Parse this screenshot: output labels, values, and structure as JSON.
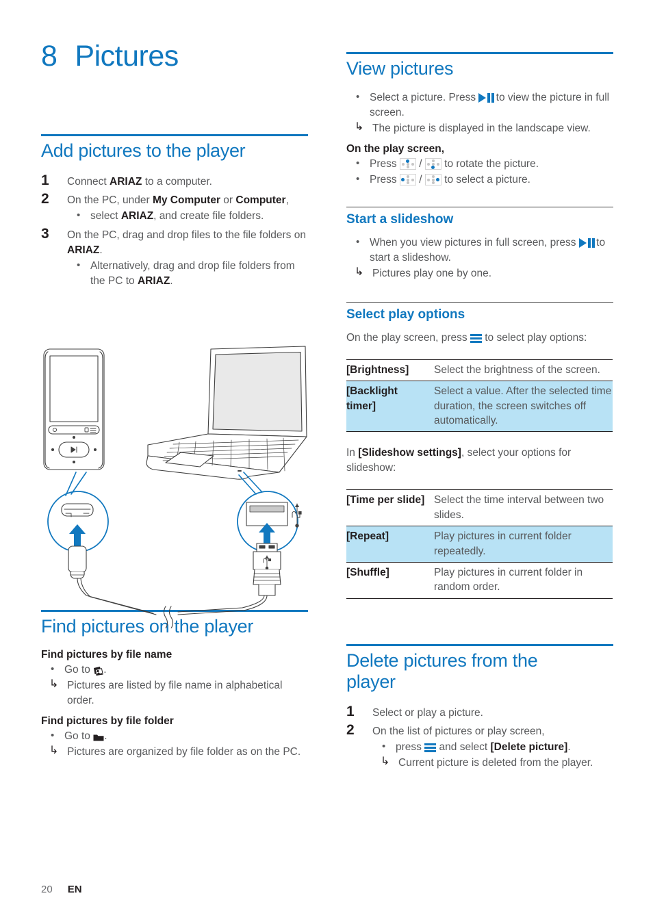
{
  "chapter": {
    "number": "8",
    "title": "Pictures"
  },
  "colors": {
    "accent": "#1178bf",
    "highlight_row": "#b8e2f5",
    "body_text": "#58595b",
    "strong_text": "#231f20"
  },
  "left_column": {
    "section_add": {
      "heading": "Add pictures to the player",
      "steps": [
        {
          "num": "1",
          "text_parts": [
            {
              "t": "Connect ",
              "b": false
            },
            {
              "t": "ARIAZ",
              "b": true
            },
            {
              "t": " to a computer.",
              "b": false
            }
          ]
        },
        {
          "num": "2",
          "text_parts": [
            {
              "t": "On the PC, under ",
              "b": false
            },
            {
              "t": "My Computer",
              "b": true
            },
            {
              "t": " or ",
              "b": false
            },
            {
              "t": "Computer",
              "b": true
            },
            {
              "t": ",",
              "b": false
            }
          ],
          "bullets": [
            [
              {
                "t": "select ",
                "b": false
              },
              {
                "t": "ARIAZ",
                "b": true
              },
              {
                "t": ", and create file folders.",
                "b": false
              }
            ]
          ]
        },
        {
          "num": "3",
          "text_parts": [
            {
              "t": "On the PC, drag and drop files to the file folders on ",
              "b": false
            },
            {
              "t": "ARIAZ",
              "b": true
            },
            {
              "t": ".",
              "b": false
            }
          ],
          "bullets": [
            [
              {
                "t": "Alternatively, drag and drop file folders from the PC to ",
                "b": false
              },
              {
                "t": "ARIAZ",
                "b": true
              },
              {
                "t": ".",
                "b": false
              }
            ]
          ]
        }
      ]
    },
    "illustration": {
      "name": "connect-player-to-pc-diagram",
      "parts": [
        "mp3-player",
        "laptop",
        "usb-micro-connector-callout",
        "usb-a-port-callout",
        "usb-cable"
      ]
    },
    "section_find": {
      "heading": "Find pictures on the player",
      "blocks": [
        {
          "lead": "Find pictures by file name",
          "bullet_prefix": "Go to ",
          "bullet_icon": "photo-icon",
          "bullet_suffix": ".",
          "result": "Pictures are listed by file name in alphabetical order."
        },
        {
          "lead": "Find pictures by file folder",
          "bullet_prefix": "Go to ",
          "bullet_icon": "folder-icon",
          "bullet_suffix": ".",
          "result": "Pictures are organized by file folder as on the PC."
        }
      ]
    }
  },
  "right_column": {
    "section_view": {
      "heading": "View pictures",
      "bullet1_pre": "Select a picture. Press ",
      "bullet1_icon": "play-pause-icon",
      "bullet1_post": " to view the picture in full screen.",
      "bullet1_result": "The picture is displayed in the landscape view.",
      "play_screen_lead": "On the play screen,",
      "rotate_pre": "Press ",
      "rotate_mid": " / ",
      "rotate_post": " to rotate the picture.",
      "rotate_icon_a": "nav-up-icon",
      "rotate_icon_b": "nav-down-icon",
      "select_pre": "Press ",
      "select_mid": " / ",
      "select_post": " to select a picture.",
      "select_icon_a": "nav-left-icon",
      "select_icon_b": "nav-right-icon"
    },
    "section_slideshow": {
      "heading": "Start a slideshow",
      "bullet_pre": "When you view pictures in full screen, press ",
      "bullet_icon": "play-pause-icon",
      "bullet_post": " to start a slideshow.",
      "result": "Pictures play one by one."
    },
    "section_play_options": {
      "heading": "Select play options",
      "intro_pre": "On the play screen, press ",
      "intro_icon": "menu-icon",
      "intro_post": " to select play options:",
      "table1": [
        {
          "key": "[Brightness]",
          "value": "Select the brightness of the screen.",
          "highlight": false
        },
        {
          "key": "[Backlight timer]",
          "value": "Select a value. After the selected time duration, the screen switches off automatically.",
          "highlight": true
        }
      ],
      "slideshow_intro_pre": "In ",
      "slideshow_intro_bold": "[Slideshow settings]",
      "slideshow_intro_post": ", select your options for slideshow:",
      "table2": [
        {
          "key": "[Time per slide]",
          "value": "Select the time interval between two slides.",
          "highlight": false
        },
        {
          "key": "[Repeat]",
          "value": "Play pictures in current folder repeatedly.",
          "highlight": true
        },
        {
          "key": "[Shuffle]",
          "value": "Play pictures in current folder in random order.",
          "highlight": false
        }
      ]
    },
    "section_delete": {
      "heading": "Delete pictures from the player",
      "steps": [
        {
          "num": "1",
          "text": "Select or play a picture."
        },
        {
          "num": "2",
          "text": "On the list of pictures or play screen,"
        }
      ],
      "bullet_pre": "press ",
      "bullet_icon": "menu-icon",
      "bullet_mid": " and select ",
      "bullet_bold": "[Delete picture]",
      "bullet_post": ".",
      "result": "Current picture is deleted from the player."
    }
  },
  "footer": {
    "page_number": "20",
    "language": "EN"
  }
}
